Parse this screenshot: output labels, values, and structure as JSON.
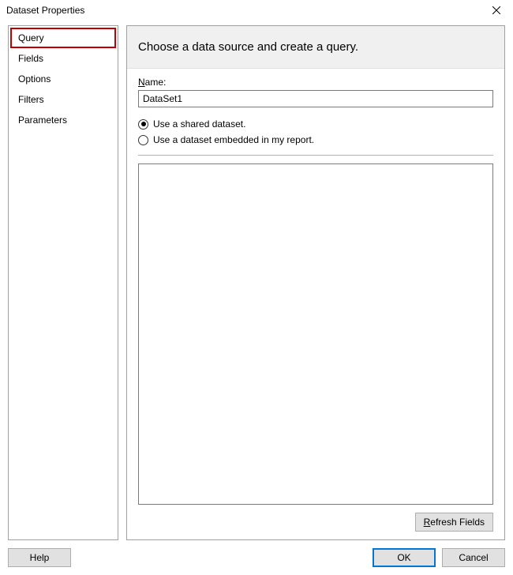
{
  "title": "Dataset Properties",
  "sidebar": {
    "items": [
      {
        "label": "Query",
        "active": true
      },
      {
        "label": "Fields",
        "active": false
      },
      {
        "label": "Options",
        "active": false
      },
      {
        "label": "Filters",
        "active": false
      },
      {
        "label": "Parameters",
        "active": false
      }
    ]
  },
  "main": {
    "header": "Choose a data source and create a query.",
    "name_label": "Name:",
    "name_value": "DataSet1",
    "radio_shared": "Use a shared dataset.",
    "radio_embedded": "Use a dataset embedded in my report.",
    "selected_radio": "shared",
    "refresh_label": "Refresh Fields"
  },
  "buttons": {
    "help": "Help",
    "ok": "OK",
    "cancel": "Cancel"
  }
}
